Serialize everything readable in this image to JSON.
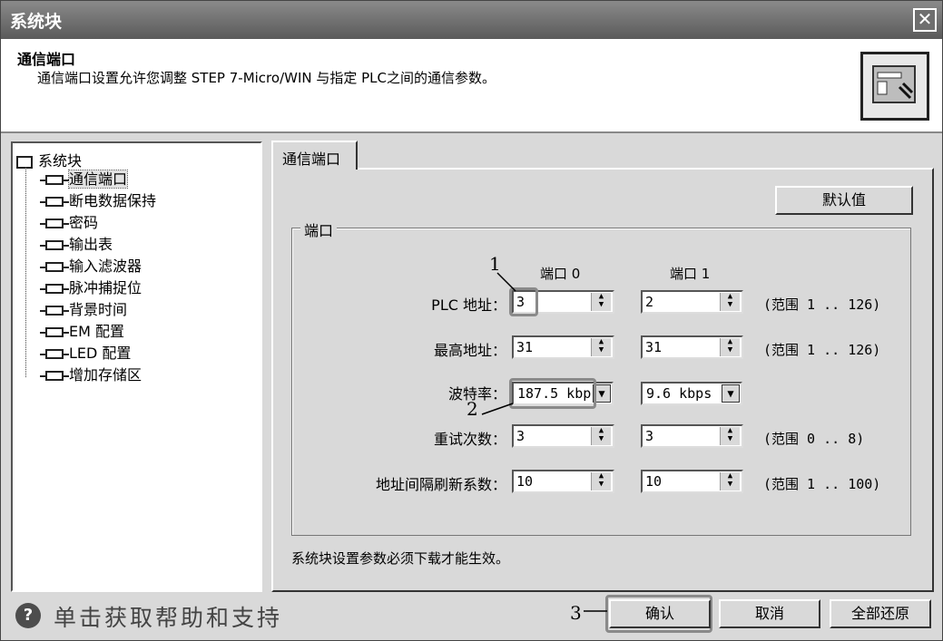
{
  "window": {
    "title": "系统块",
    "close_glyph": "✕"
  },
  "header": {
    "title": "通信端口",
    "description": "通信端口设置允许您调整 STEP 7-Micro/WIN 与指定 PLC之间的通信参数。",
    "icon": "system-block-icon"
  },
  "tree": {
    "root": "系统块",
    "items": [
      {
        "label": "通信端口",
        "selected": true
      },
      {
        "label": "断电数据保持"
      },
      {
        "label": "密码"
      },
      {
        "label": "输出表"
      },
      {
        "label": "输入滤波器"
      },
      {
        "label": "脉冲捕捉位"
      },
      {
        "label": "背景时间"
      },
      {
        "label": "EM 配置"
      },
      {
        "label": "LED 配置"
      },
      {
        "label": "增加存储区"
      }
    ]
  },
  "tab": {
    "label": "通信端口"
  },
  "default_button": "默认值",
  "group": {
    "label": "端口",
    "col_port0": "端口 0",
    "col_port1": "端口 1",
    "rows": {
      "plc_address": {
        "label": "PLC 地址：",
        "port0": "3",
        "port1": "2",
        "range": "(范围 1 .. 126)"
      },
      "max_address": {
        "label": "最高地址：",
        "port0": "31",
        "port1": "31",
        "range": "(范围 1 .. 126)"
      },
      "baud_rate": {
        "label": "波特率：",
        "port0": "187.5 kbp",
        "port1": "9.6 kbps"
      },
      "retry_count": {
        "label": "重试次数：",
        "port0": "3",
        "port1": "3",
        "range": "(范围 0 .. 8)"
      },
      "gap_update": {
        "label": "地址间隔刷新系数：",
        "port0": "10",
        "port1": "10",
        "range": "(范围 1 .. 100)"
      }
    }
  },
  "note": "系统块设置参数必须下载才能生效。",
  "footer": {
    "help_text": "单击获取帮助和支持",
    "ok": "确认",
    "cancel": "取消",
    "restore_all": "全部还原"
  },
  "callouts": [
    "1",
    "2",
    "3"
  ]
}
